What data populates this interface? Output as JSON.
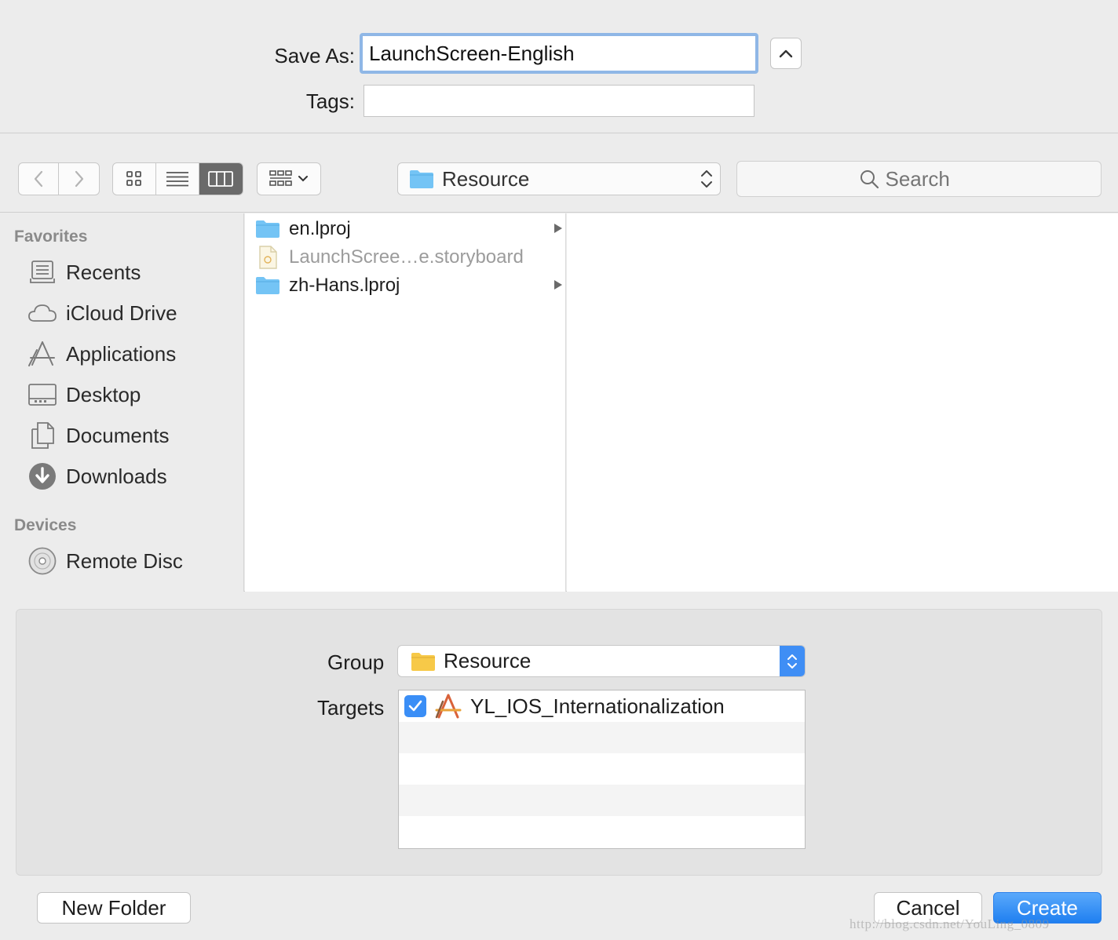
{
  "save_as": {
    "label": "Save As:",
    "value": "LaunchScreen-English"
  },
  "tags": {
    "label": "Tags:",
    "value": ""
  },
  "toolbar": {
    "location": "Resource",
    "search_placeholder": "Search",
    "active_view": "columns"
  },
  "sidebar": {
    "favorites_heading": "Favorites",
    "favorites": [
      {
        "label": "Recents",
        "icon": "recents-icon"
      },
      {
        "label": "iCloud Drive",
        "icon": "cloud-icon"
      },
      {
        "label": "Applications",
        "icon": "applications-icon"
      },
      {
        "label": "Desktop",
        "icon": "desktop-icon"
      },
      {
        "label": "Documents",
        "icon": "documents-icon"
      },
      {
        "label": "Downloads",
        "icon": "downloads-icon"
      }
    ],
    "devices_heading": "Devices",
    "devices": [
      {
        "label": "Remote Disc",
        "icon": "disc-icon"
      }
    ]
  },
  "files": [
    {
      "name": "en.lproj",
      "kind": "folder",
      "enabled": true
    },
    {
      "name": "LaunchScree…e.storyboard",
      "kind": "storyboard",
      "enabled": false
    },
    {
      "name": "zh-Hans.lproj",
      "kind": "folder",
      "enabled": true
    }
  ],
  "options": {
    "group_label": "Group",
    "group_value": "Resource",
    "targets_label": "Targets",
    "targets": [
      {
        "name": "YL_IOS_Internationalization",
        "checked": true
      }
    ]
  },
  "buttons": {
    "new_folder": "New Folder",
    "cancel": "Cancel",
    "create": "Create"
  },
  "watermark": "http://blog.csdn.net/YouLing_0809",
  "colors": {
    "accent": "#3a8ef6",
    "focus_ring": "#8fb7e6",
    "folder_blue": "#74c4f5",
    "folder_yellow": "#f7c948"
  }
}
